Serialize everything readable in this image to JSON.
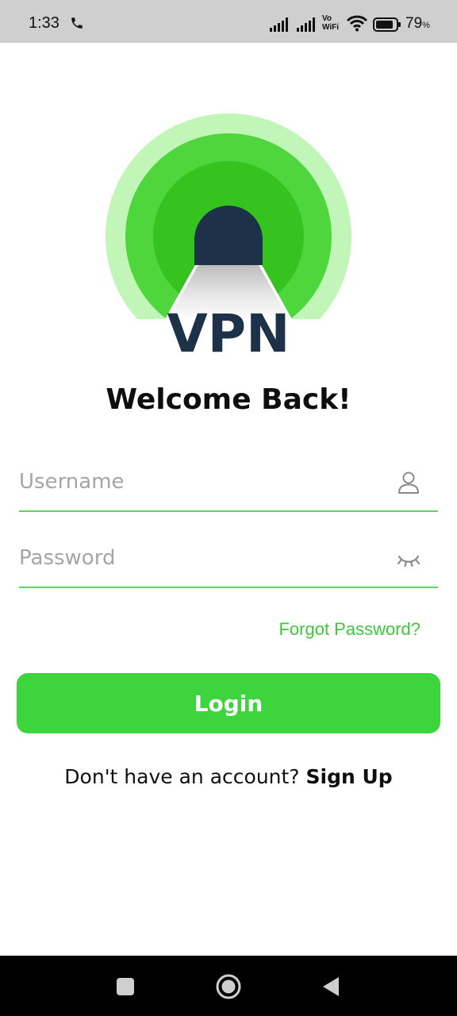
{
  "status_bar": {
    "time": "1:33",
    "vo_line1": "Vo",
    "vo_line2": "WiFi",
    "battery_percent": "79",
    "battery_unit": "%",
    "icons": [
      "phone-call-icon",
      "cellular-signal-icon",
      "cellular-signal-icon",
      "wifi-icon",
      "battery-icon"
    ]
  },
  "logo": {
    "text": "VPN"
  },
  "welcome": {
    "title": "Welcome Back!"
  },
  "form": {
    "username_placeholder": "Username",
    "username_value": "",
    "password_placeholder": "Password",
    "password_value": "",
    "forgot_label": "Forgot Password?",
    "login_label": "Login"
  },
  "signup": {
    "prompt": "Don't have an account?",
    "link": "Sign Up"
  },
  "colors": {
    "accent": "#3dd43d",
    "underline": "#5fd35f",
    "forgot_link": "#3cc83c",
    "logo_navy": "#1d3148"
  }
}
